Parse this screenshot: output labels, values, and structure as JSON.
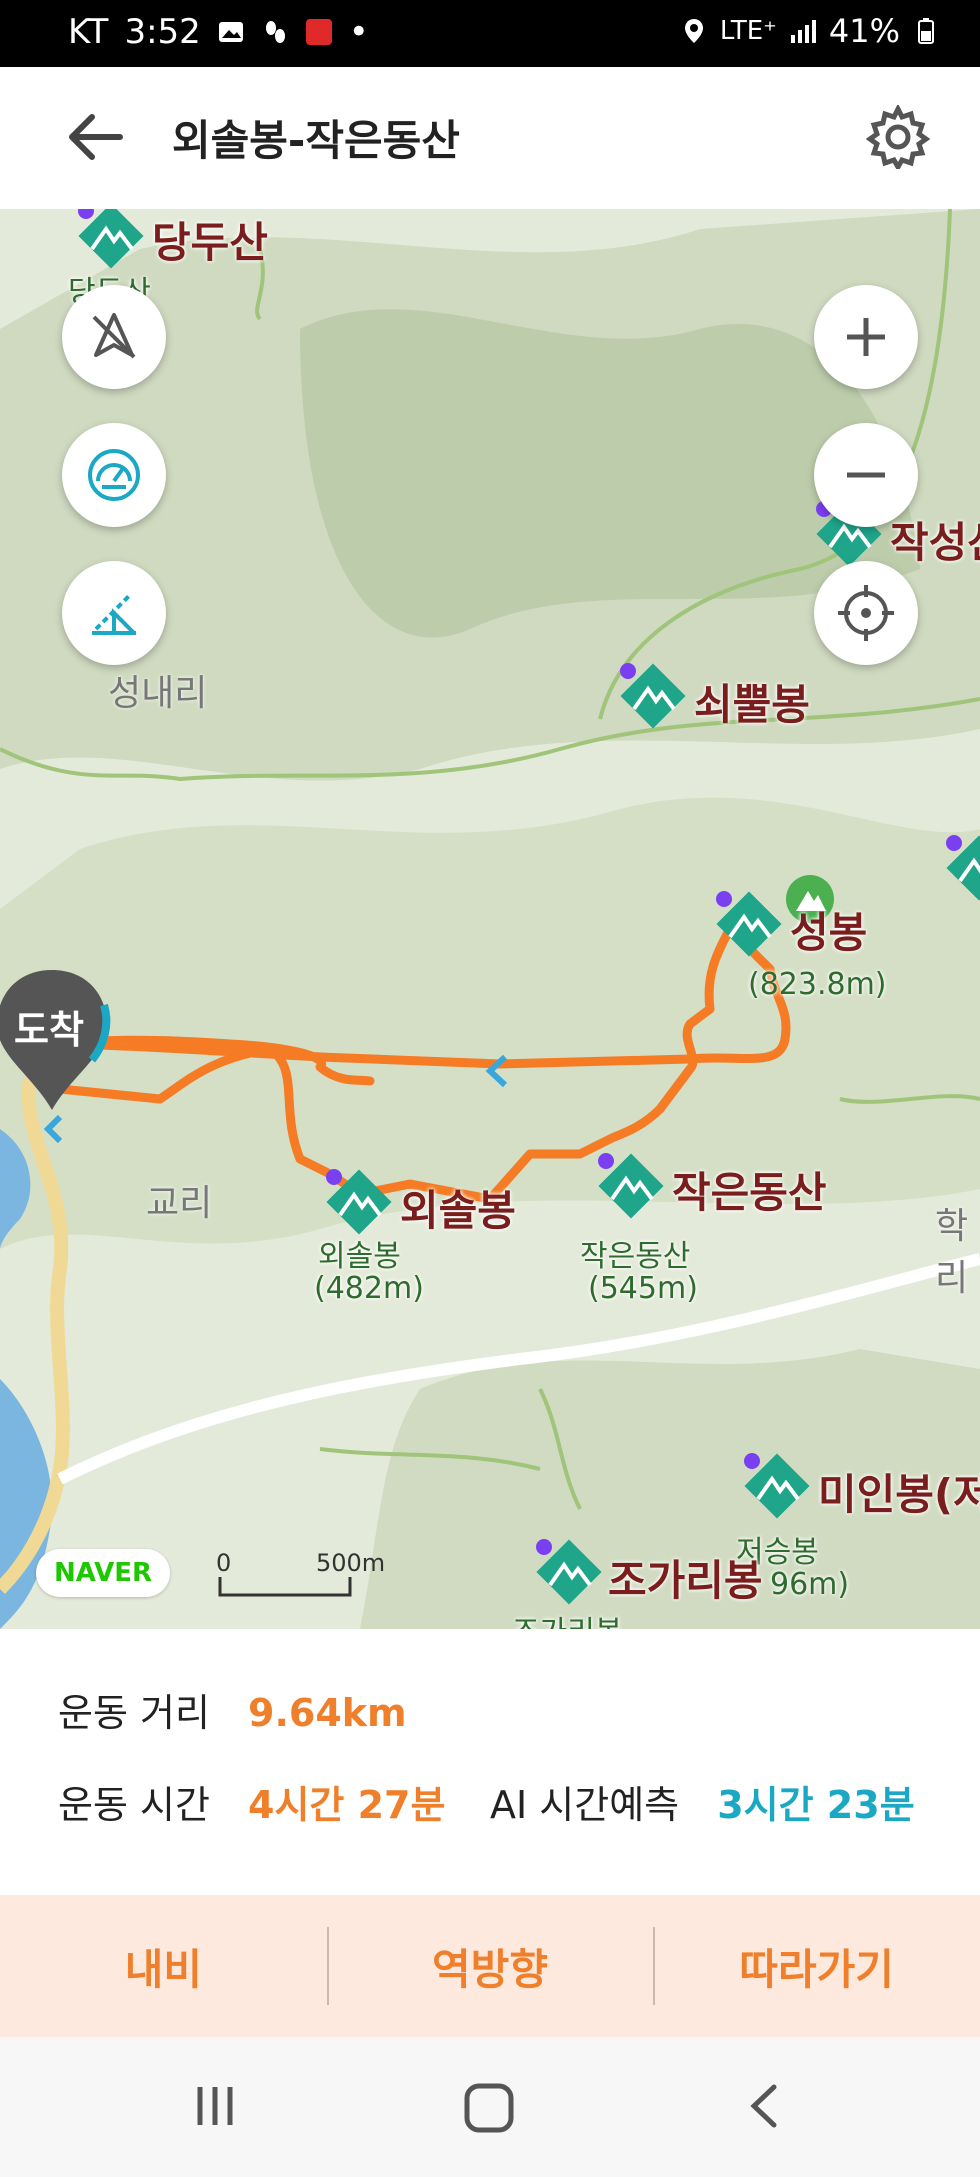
{
  "status_bar": {
    "carrier": "KT",
    "time": "3:52",
    "network": "LTE⁺",
    "battery": "41%"
  },
  "header": {
    "title": "외솔봉-작은동산"
  },
  "map": {
    "arrival_marker": "도착",
    "places": [
      "성내리",
      "교리",
      "학리"
    ],
    "peaks": [
      {
        "name": "당두산",
        "sub": "당두산"
      },
      {
        "name": "작성산",
        "sub": "("
      },
      {
        "name": "쇠뿔봉",
        "sub": ""
      },
      {
        "name": "성봉",
        "sub": "(823.8m)"
      },
      {
        "name": "외솔봉",
        "sub": "외솔봉",
        "height": "(482m)"
      },
      {
        "name": "작은동산",
        "sub": "작은동산",
        "height": "(545m)"
      },
      {
        "name": "미인봉(저",
        "sub": "저승봉",
        "height": "96m)"
      },
      {
        "name": "조가리봉",
        "sub": "조가리봉"
      }
    ],
    "logo": "NAVER",
    "scale": {
      "start": "0",
      "end": "500m"
    }
  },
  "stats": {
    "distance_label": "운동 거리",
    "distance_value": "9.64km",
    "time_label": "운동 시간",
    "time_value": "4시간 27분",
    "ai_label": "AI 시간예측",
    "ai_value": "3시간 23분"
  },
  "actions": {
    "navi": "내비",
    "reverse": "역방향",
    "follow": "따라가기"
  },
  "colors": {
    "route": "#f57b25",
    "accent_orange": "#ef7f2b",
    "accent_teal": "#1aa8c4",
    "peak_icon": "#1ea58a"
  },
  "icons": [
    "back-arrow-icon",
    "gear-icon",
    "compass-off-icon",
    "speedometer-icon",
    "slope-icon",
    "zoom-in-icon",
    "zoom-out-icon",
    "locate-icon",
    "mountain-peak-icon"
  ]
}
